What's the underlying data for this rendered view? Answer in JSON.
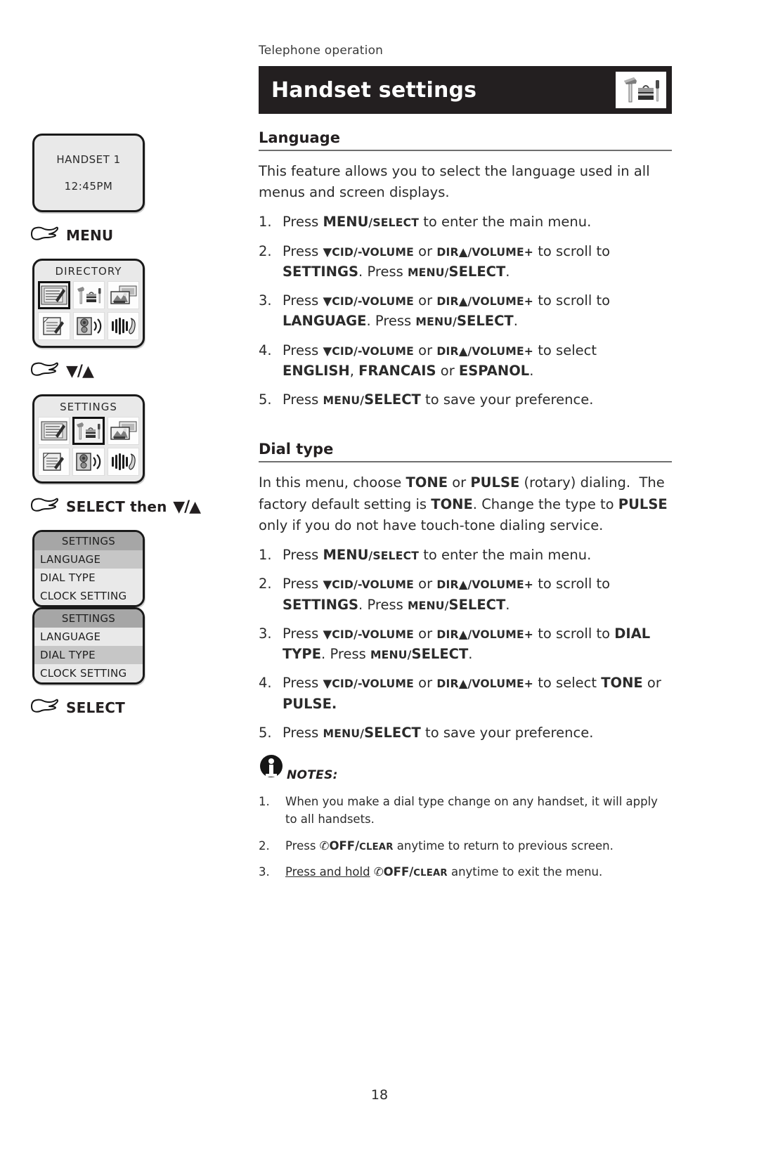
{
  "page": {
    "kicker": "Telephone operation",
    "banner_title": "Handset settings",
    "banner_icon": "tools-toolbox-icon",
    "page_number": "18"
  },
  "rail": {
    "screens": [
      {
        "type": "status",
        "name": "handset-status-screen",
        "lines": [
          "HANDSET 1",
          "12:45PM"
        ]
      },
      {
        "type": "hand",
        "name": "hand-pointer-menu",
        "label": "MENU",
        "arrows": ""
      },
      {
        "type": "icongrid",
        "name": "directory-menu-screen",
        "title": "DIRECTORY",
        "selected": 0,
        "icons": [
          "directory-book-icon",
          "tools-toolbox-icon",
          "photos-icon",
          "clipboard-icon",
          "speaker-icon",
          "ringer-handset-icon"
        ]
      },
      {
        "type": "hand",
        "name": "hand-pointer-scroll",
        "label": "",
        "arrows": "▼/▲"
      },
      {
        "type": "icongrid",
        "name": "settings-menu-screen",
        "title": "SETTINGS",
        "selected": 1,
        "icons": [
          "directory-book-icon",
          "tools-toolbox-icon",
          "photos-icon",
          "clipboard-icon",
          "speaker-icon",
          "ringer-handset-icon"
        ]
      },
      {
        "type": "hand",
        "name": "hand-pointer-select-then-scroll",
        "label": "SELECT then",
        "arrows": "▼/▲"
      },
      {
        "type": "list",
        "name": "settings-list-language-screen",
        "header": "SETTINGS",
        "items": [
          "LANGUAGE",
          "DIAL TYPE",
          "CLOCK SETTING"
        ],
        "highlighted": 0
      },
      {
        "type": "list",
        "name": "settings-list-dialtype-screen",
        "header": "SETTINGS",
        "items": [
          "LANGUAGE",
          "DIAL TYPE",
          "CLOCK SETTING"
        ],
        "highlighted": 1
      },
      {
        "type": "hand",
        "name": "hand-pointer-select",
        "label": "SELECT",
        "arrows": ""
      }
    ]
  },
  "language_section": {
    "heading": "Language",
    "intro": "This feature allows you to select the language used in all menus and screen displays.",
    "steps": [
      {
        "num": "1.",
        "html": "Press <b class=\"big\">MENU</b><b class=\"sc\">/SELECT</b> to enter the main menu."
      },
      {
        "num": "2.",
        "html": "Press <span class=\"tri\">▼</span><b class=\"sc\">CID/-VOLUME</b> or <b class=\"sc\">DIR</b><span class=\"tri\">▲</span><b class=\"sc\">/VOLUME+</b> to scroll to <b class=\"big\">SETTINGS</b>. Press <b class=\"sc\">MENU/</b><b class=\"big\">SELECT</b>."
      },
      {
        "num": "3.",
        "html": "Press <span class=\"tri\">▼</span><b class=\"sc\">CID/-VOLUME</b> or <b class=\"sc\">DIR</b><span class=\"tri\">▲</span><b class=\"sc\">/VOLUME+</b> to scroll to <b class=\"big\">LANGUAGE</b>. Press <b class=\"sc\">MENU/</b><b class=\"big\">SELECT</b>."
      },
      {
        "num": "4.",
        "html": "Press <span class=\"tri\">▼</span><b class=\"sc\">CID/-VOLUME</b> or <b class=\"sc\">DIR</b><span class=\"tri\">▲</span><b class=\"sc\">/VOLUME+</b> to select <b class=\"big\">ENGLISH</b>, <b class=\"big\">FRANCAIS</b> or <b class=\"big\">ESPANOL</b>."
      },
      {
        "num": "5.",
        "html": "Press <b class=\"sc\">MENU/</b><b class=\"big\">SELECT</b> to save your preference."
      }
    ]
  },
  "dialtype_section": {
    "heading": "Dial type",
    "intro_html": "In this menu, choose <b class=\"big\">TONE</b> or <b class=\"big\">PULSE</b> (rotary) dialing.&nbsp; The factory default setting is <b class=\"big\">TONE</b>. Change the type to <b class=\"big\">PULSE</b> only if you do not have touch-tone dialing service.",
    "steps": [
      {
        "num": "1.",
        "html": "Press <b class=\"big\">MENU</b><b class=\"sc\">/SELECT</b> to enter the main menu."
      },
      {
        "num": "2.",
        "html": "Press <span class=\"tri\">▼</span><b class=\"sc\">CID/-VOLUME</b> or <b class=\"sc\">DIR</b><span class=\"tri\">▲</span><b class=\"sc\">/VOLUME+</b> to scroll to <b class=\"big\">SETTINGS</b>. Press <b class=\"sc\">MENU/</b><b class=\"big\">SELECT</b>."
      },
      {
        "num": "3.",
        "html": "Press <span class=\"tri\">▼</span><b class=\"sc\">CID/-VOLUME</b> or <b class=\"sc\">DIR</b><span class=\"tri\">▲</span><b class=\"sc\">/VOLUME+</b> to scroll to <b class=\"big\">DIAL TYPE</b>. Press <b class=\"sc\">MENU/</b><b class=\"big\">SELECT</b>."
      },
      {
        "num": "4.",
        "html": "Press <span class=\"tri\">▼</span><b class=\"sc\">CID/-VOLUME</b> or <b class=\"sc\">DIR</b><span class=\"tri\">▲</span><b class=\"sc\">/VOLUME+</b> to select <b class=\"big\">TONE</b> or <b class=\"big\">PULSE.</b>"
      },
      {
        "num": "5.",
        "html": "Press <b class=\"sc\">MENU/</b><b class=\"big\">SELECT</b> to save your preference."
      }
    ]
  },
  "notes": {
    "label": "NOTES:",
    "icon": "info-circle-icon",
    "items": [
      {
        "num": "1.",
        "html": "When you make a dial type change on any handset, it will apply to all handsets."
      },
      {
        "num": "2.",
        "html": "Press <span class=\"phico\">✆</span><b class=\"big\">OFF/</b><b class=\"sc\">CLEAR</b> anytime to return to previous screen."
      },
      {
        "num": "3.",
        "html": "<span class=\"ul\">Press and hold</span> <span class=\"phico\">✆</span><b class=\"big\">OFF/</b><b class=\"sc\">CLEAR</b> anytime to exit the menu."
      }
    ]
  },
  "colors": {
    "banner_bg": "#231f20",
    "lcd_bg": "#e9e9e9",
    "lcd_header": "#a6a6a6",
    "lcd_highlight": "#c6c6c6",
    "text": "#231f20"
  }
}
